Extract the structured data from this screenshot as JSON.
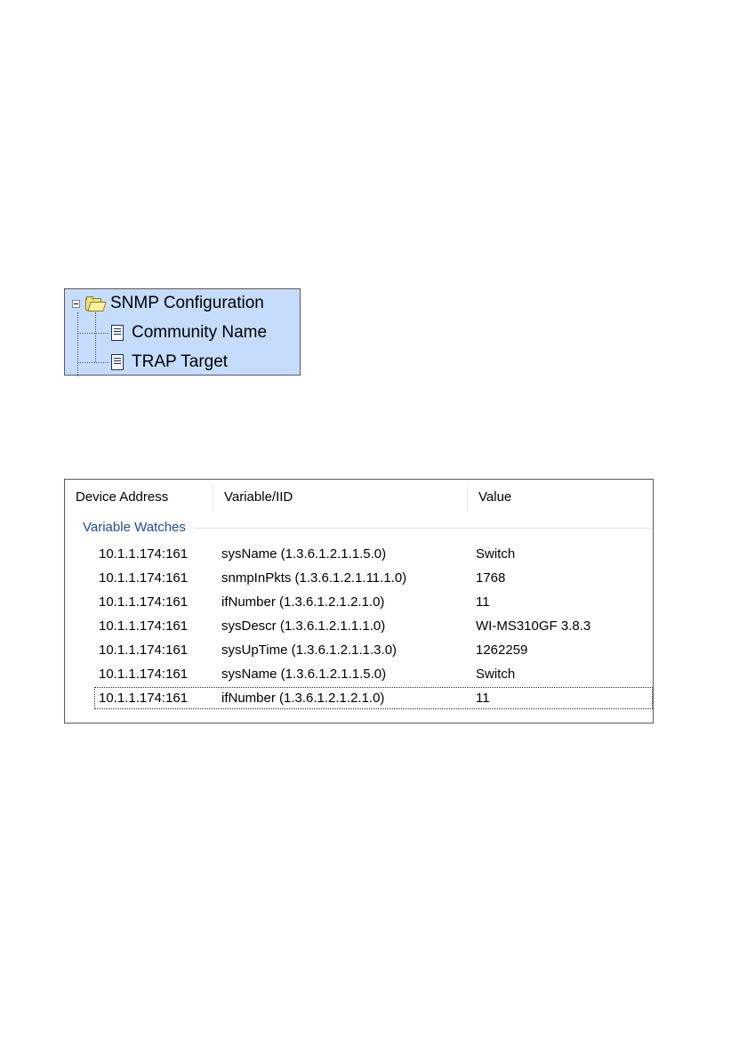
{
  "tree": {
    "root": {
      "icon": "folder-open-icon",
      "label": "SNMP Configuration"
    },
    "children": [
      {
        "icon": "document-icon",
        "label": "Community Name"
      },
      {
        "icon": "document-icon",
        "label": "TRAP Target"
      }
    ]
  },
  "list": {
    "columns": [
      "Device Address",
      "Variable/IID",
      "Value"
    ],
    "group": "Variable Watches",
    "rows": [
      {
        "address": "10.1.1.174:161",
        "variable": "sysName (1.3.6.1.2.1.1.5.0)",
        "value": "Switch"
      },
      {
        "address": "10.1.1.174:161",
        "variable": "snmpInPkts (1.3.6.1.2.1.11.1.0)",
        "value": "1768"
      },
      {
        "address": "10.1.1.174:161",
        "variable": "ifNumber (1.3.6.1.2.1.2.1.0)",
        "value": "11"
      },
      {
        "address": "10.1.1.174:161",
        "variable": "sysDescr (1.3.6.1.2.1.1.1.0)",
        "value": "WI-MS310GF 3.8.3"
      },
      {
        "address": "10.1.1.174:161",
        "variable": "sysUpTime (1.3.6.1.2.1.1.3.0)",
        "value": "1262259"
      },
      {
        "address": "10.1.1.174:161",
        "variable": "sysName (1.3.6.1.2.1.1.5.0)",
        "value": "Switch"
      },
      {
        "address": "10.1.1.174:161",
        "variable": "ifNumber (1.3.6.1.2.1.2.1.0)",
        "value": "11"
      }
    ]
  }
}
